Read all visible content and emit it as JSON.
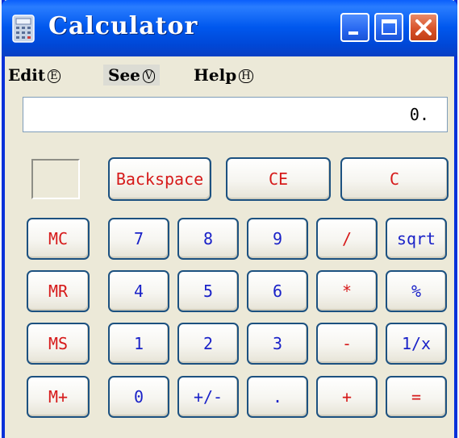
{
  "window": {
    "title": "Calculator"
  },
  "menu": [
    {
      "label": "Edit",
      "accel": "E"
    },
    {
      "label": "See",
      "accel": "V"
    },
    {
      "label": "Help",
      "accel": "H"
    }
  ],
  "display": {
    "value": "0."
  },
  "buttons": {
    "backspace": "Backspace",
    "ce": "CE",
    "c": "C",
    "mc": "MC",
    "mr": "MR",
    "ms": "MS",
    "mplus": "M+",
    "seven": "7",
    "eight": "8",
    "nine": "9",
    "divide": "/",
    "sqrt": "sqrt",
    "four": "4",
    "five": "5",
    "six": "6",
    "multiply": "*",
    "percent": "%",
    "one": "1",
    "two": "2",
    "three": "3",
    "minus": "-",
    "reciprocal": "1/x",
    "zero": "0",
    "sign": "+/-",
    "decimal": ".",
    "plus": "+",
    "equals": "="
  },
  "colors": {
    "titlebar": "#0058ee",
    "key_red": "#d61a1a",
    "key_blue": "#1a22c8",
    "window_bg": "#ece9d8"
  },
  "icons": [
    "calculator-icon",
    "minimize-icon",
    "maximize-icon",
    "close-icon"
  ]
}
